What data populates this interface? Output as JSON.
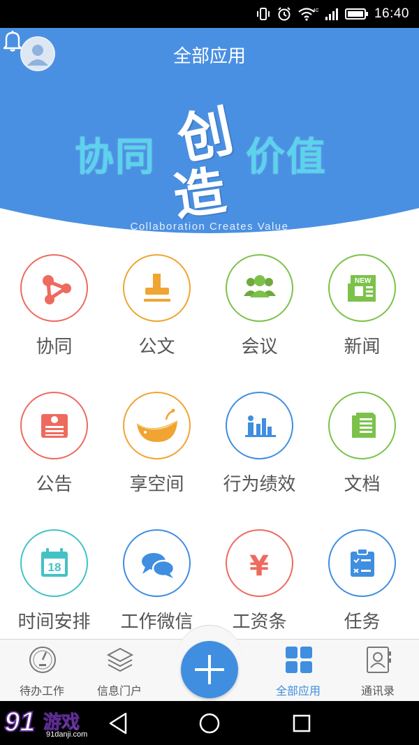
{
  "status_bar": {
    "time": "16:40",
    "network": "4G",
    "icons": [
      "vibrate-icon",
      "alarm-icon",
      "wifi-icon",
      "signal-icon",
      "battery-icon"
    ]
  },
  "header": {
    "title": "全部应用",
    "avatar_icon": "user-avatar-icon",
    "bell_icon": "bell-icon"
  },
  "banner": {
    "slogan_left": "协同",
    "calligraphy_top": "创",
    "calligraphy_bottom": "造",
    "slogan_right": "价值",
    "slogan_en": "Collaboration Creates Value",
    "colors": {
      "background": "#4a90e2",
      "slogan": "#5cd3ec"
    }
  },
  "apps": [
    {
      "label": "协同",
      "icon": "share-nodes-icon",
      "color": "#ee6a5f"
    },
    {
      "label": "公文",
      "icon": "stamp-icon",
      "color": "#f0a431"
    },
    {
      "label": "会议",
      "icon": "people-group-icon",
      "color": "#7cc24a"
    },
    {
      "label": "新闻",
      "icon": "newspaper-icon",
      "badge": "NEW",
      "color": "#7cc24a"
    },
    {
      "label": "公告",
      "icon": "announcement-icon",
      "color": "#ee6a5f"
    },
    {
      "label": "享空间",
      "icon": "whale-icon",
      "color": "#f0a431"
    },
    {
      "label": "行为绩效",
      "icon": "bar-chart-icon",
      "color": "#3f8ee0"
    },
    {
      "label": "文档",
      "icon": "document-icon",
      "color": "#7cc24a"
    },
    {
      "label": "时间安排",
      "icon": "calendar-icon",
      "day": "18",
      "color": "#43c2c6"
    },
    {
      "label": "工作微信",
      "icon": "chat-bubbles-icon",
      "color": "#3f8ee0"
    },
    {
      "label": "工资条",
      "icon": "yen-icon",
      "symbol": "¥",
      "color": "#ee6a5f"
    },
    {
      "label": "任务",
      "icon": "task-clipboard-icon",
      "color": "#3f8ee0"
    }
  ],
  "tab_bar": {
    "items": [
      {
        "label": "待办工作",
        "icon": "gauge-icon"
      },
      {
        "label": "信息门户",
        "icon": "layers-icon"
      },
      {
        "label": "全部应用",
        "icon": "grid-icon",
        "active": true
      },
      {
        "label": "通讯录",
        "icon": "contacts-icon"
      }
    ],
    "fab_icon": "plus-icon",
    "active_color": "#3f8ee0"
  },
  "nav_bar": {
    "buttons": [
      "back-icon",
      "home-icon",
      "recent-apps-icon"
    ]
  },
  "watermark": {
    "number": "91",
    "text": "游戏",
    "url": "91danji.com"
  }
}
